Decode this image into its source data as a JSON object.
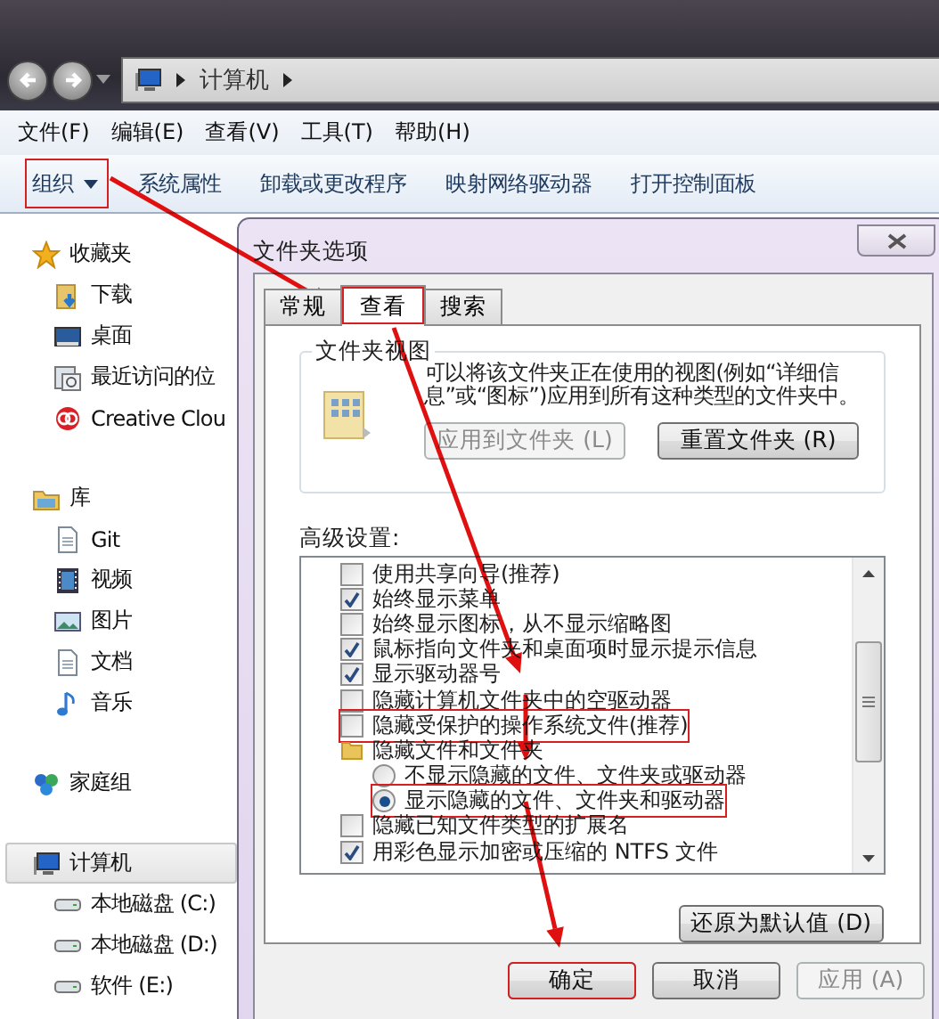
{
  "address_bar": {
    "path": [
      "计算机"
    ]
  },
  "menu_bar": [
    "文件(F)",
    "编辑(E)",
    "查看(V)",
    "工具(T)",
    "帮助(H)"
  ],
  "toolbar": [
    {
      "label": "组织",
      "kind": "dropdown",
      "highlighted": true
    },
    {
      "label": "系统属性",
      "kind": "button",
      "highlighted": false
    },
    {
      "label": "卸载或更改程序",
      "kind": "button",
      "highlighted": false
    },
    {
      "label": "映射网络驱动器",
      "kind": "button",
      "highlighted": false
    },
    {
      "label": "打开控制面板",
      "kind": "button",
      "highlighted": false
    }
  ],
  "navigation": [
    {
      "label": "收藏夹",
      "kind": "favorites",
      "selected": false,
      "children": [
        {
          "label": "下载",
          "kind": "downloads",
          "selected": false
        },
        {
          "label": "桌面",
          "kind": "desktop",
          "selected": false
        },
        {
          "label": "最近访问的位",
          "kind": "recent",
          "selected": false
        },
        {
          "label": "Creative Clou",
          "kind": "cloud",
          "selected": false
        }
      ]
    },
    {
      "label": "库",
      "kind": "libraries",
      "selected": false,
      "children": [
        {
          "label": "Git",
          "kind": "document",
          "selected": false
        },
        {
          "label": "视频",
          "kind": "video",
          "selected": false
        },
        {
          "label": "图片",
          "kind": "pictures",
          "selected": false
        },
        {
          "label": "文档",
          "kind": "document",
          "selected": false
        },
        {
          "label": "音乐",
          "kind": "music",
          "selected": false
        }
      ]
    },
    {
      "label": "家庭组",
      "kind": "homegroup",
      "selected": false
    },
    {
      "label": "计算机",
      "kind": "computer",
      "selected": true,
      "children": [
        {
          "label": "本地磁盘 (C:)",
          "kind": "drive",
          "selected": false
        },
        {
          "label": "本地磁盘 (D:)",
          "kind": "drive",
          "selected": false
        },
        {
          "label": "软件 (E:)",
          "kind": "drive",
          "selected": false
        }
      ]
    }
  ],
  "dialog": {
    "title": "文件夹选项",
    "tabs": [
      {
        "label": "常规",
        "selected": false,
        "highlighted": false
      },
      {
        "label": "查看",
        "selected": true,
        "highlighted": true
      },
      {
        "label": "搜索",
        "selected": false,
        "highlighted": false
      }
    ],
    "folder_views": {
      "heading": "文件夹视图",
      "description": "可以将该文件夹正在使用的视图(例如“详细信息”或“图标”)应用到所有这种类型的文件夹中。",
      "buttons": [
        {
          "label": "应用到文件夹 (L)",
          "disabled": true
        },
        {
          "label": "重置文件夹 (R)",
          "disabled": false
        }
      ]
    },
    "advanced": {
      "label": "高级设置:",
      "items": [
        {
          "kind": "checkbox",
          "label": "使用共享向导(推荐)",
          "checked": false,
          "highlighted": false
        },
        {
          "kind": "checkbox",
          "label": "始终显示菜单",
          "checked": true,
          "highlighted": false
        },
        {
          "kind": "checkbox",
          "label": "始终显示图标，从不显示缩略图",
          "checked": false,
          "highlighted": false
        },
        {
          "kind": "checkbox",
          "label": "鼠标指向文件夹和桌面项时显示提示信息",
          "checked": true,
          "highlighted": false
        },
        {
          "kind": "checkbox",
          "label": "显示驱动器号",
          "checked": true,
          "highlighted": false
        },
        {
          "kind": "checkbox",
          "label": "隐藏计算机文件夹中的空驱动器",
          "checked": false,
          "highlighted": false
        },
        {
          "kind": "checkbox",
          "label": "隐藏受保护的操作系统文件(推荐)",
          "checked": false,
          "highlighted": true
        },
        {
          "kind": "folder",
          "label": "隐藏文件和文件夹",
          "children": [
            {
              "kind": "radio",
              "label": "不显示隐藏的文件、文件夹或驱动器",
              "selected": false,
              "highlighted": false
            },
            {
              "kind": "radio",
              "label": "显示隐藏的文件、文件夹和驱动器",
              "selected": true,
              "highlighted": true
            }
          ]
        },
        {
          "kind": "checkbox",
          "label": "隐藏已知文件类型的扩展名",
          "checked": false,
          "highlighted": false
        },
        {
          "kind": "checkbox",
          "label": "用彩色显示加密或压缩的 NTFS 文件",
          "checked": true,
          "highlighted": false
        }
      ]
    },
    "restore_button": "还原为默认值 (D)",
    "buttons": [
      {
        "label": "确定",
        "disabled": false,
        "highlighted": true
      },
      {
        "label": "取消",
        "disabled": false,
        "highlighted": false
      },
      {
        "label": "应用 (A)",
        "disabled": true,
        "highlighted": false
      }
    ]
  }
}
